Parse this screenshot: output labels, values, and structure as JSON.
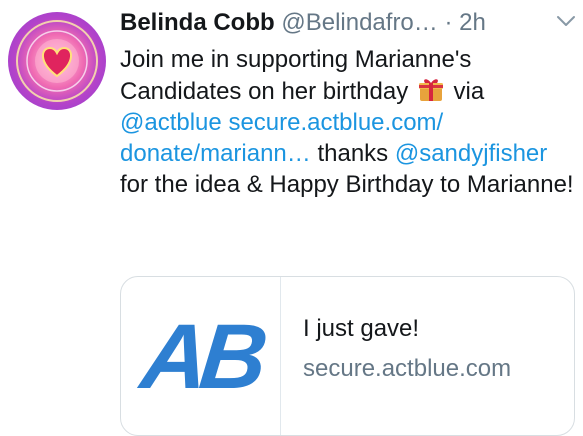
{
  "tweet": {
    "author_name": "Belinda Cobb",
    "handle": "@Belindafro…",
    "separator": "·",
    "time": "2h",
    "text_1": "Join me in supporting Marianne's Candidates on her birthday",
    "text_2": "via",
    "mention_actblue": "@actblue",
    "link": "secure.actblue.com/ donate/mariann…",
    "text_3": "thanks",
    "mention_sandy": "@sandyjfisher",
    "text_4": "for the idea & Happy Birthday to Marianne!"
  },
  "card": {
    "logo_text": "AB",
    "title": "I just gave!",
    "domain": "secure.actblue.com"
  },
  "icons": {
    "avatar": "heart-mandala-avatar",
    "gift": "wrapped-gift-emoji",
    "menu": "chevron-down-icon"
  },
  "colors": {
    "link": "#1b95e0",
    "secondary": "#657786",
    "card_border": "#d8dee2",
    "actblue_blue": "#2e7fd1"
  }
}
